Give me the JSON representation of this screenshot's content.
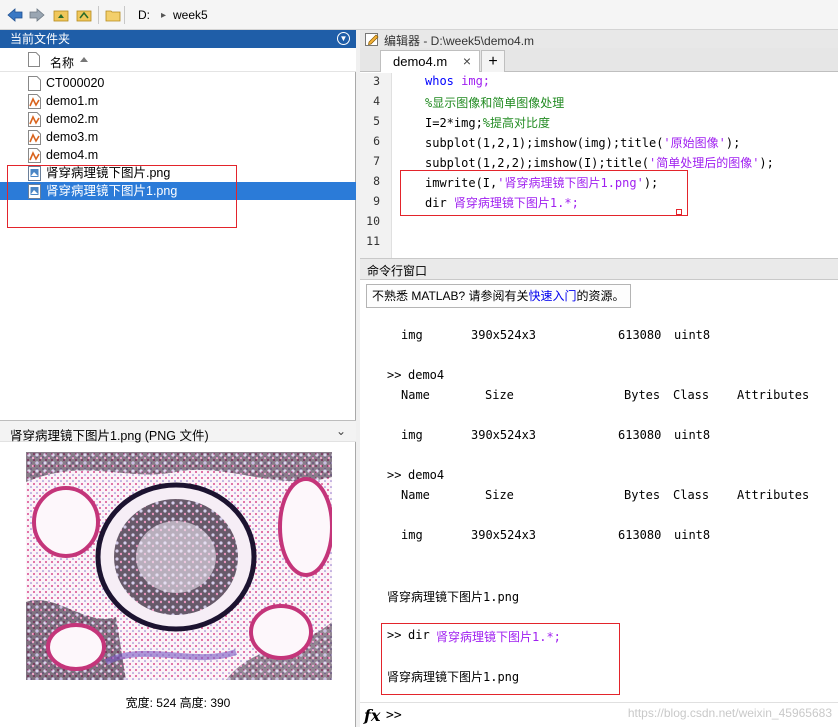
{
  "toolbar": {
    "path": [
      "D:",
      "week5"
    ],
    "separator": "▸"
  },
  "current_folder": {
    "title": "当前文件夹",
    "column_name": "名称",
    "files": [
      {
        "name": "CT000020",
        "icon": "blank-file-icon"
      },
      {
        "name": "demo1.m",
        "icon": "m-file-icon"
      },
      {
        "name": "demo2.m",
        "icon": "m-file-icon"
      },
      {
        "name": "demo3.m",
        "icon": "m-file-icon"
      },
      {
        "name": "demo4.m",
        "icon": "m-file-icon"
      },
      {
        "name": "肾穿病理镜下图片.png",
        "icon": "png-file-icon"
      },
      {
        "name": "肾穿病理镜下图片1.png",
        "icon": "png-file-icon",
        "selected": true
      }
    ]
  },
  "preview": {
    "title": "肾穿病理镜下图片1.png  (PNG 文件)",
    "dimensions": "宽度: 524 高度: 390"
  },
  "editor": {
    "title": "编辑器 - D:\\week5\\demo4.m",
    "tab_label": "demo4.m",
    "tab_close": "×",
    "add_tab": "+",
    "line_numbers": [
      "3",
      "4",
      "5",
      "6",
      "7",
      "8",
      "9",
      "10",
      "11"
    ],
    "lines": {
      "l3a": "whos ",
      "l3b": "img;",
      "l4": "%显示图像和简单图像处理",
      "l5a": "I=2*img;",
      "l5b": "%提高对比度",
      "l6a": "subplot(1,2,1);imshow(img);title(",
      "l6b": "'原始图像'",
      "l6c": ");",
      "l7a": "subplot(1,2,2);imshow(I);title(",
      "l7b": "'简单处理后的图像'",
      "l7c": ");",
      "l8a": "imwrite(I,",
      "l8b": "'肾穿病理镜下图片1.png'",
      "l8c": ");",
      "l9a": "dir ",
      "l9b": "肾穿病理镜下图片1.*;"
    }
  },
  "command_window": {
    "title": "命令行窗口",
    "notice_pre": "不熟悉 MATLAB? 请参阅有关",
    "notice_link": "快速入门",
    "notice_post": "的资源。",
    "var_row": {
      "name": "img",
      "size": "390x524x3",
      "bytes": "613080",
      "class": "uint8"
    },
    "prompt": ">>",
    "cmd_demo4": "demo4",
    "headers": {
      "name": "Name",
      "size": "Size",
      "bytes": "Bytes",
      "class": "Class",
      "attributes": "Attributes"
    },
    "output_file": "肾穿病理镜下图片1.png",
    "dir_cmd": "dir",
    "dir_arg": "肾穿病理镜下图片1.*;",
    "fx": "fx"
  },
  "watermark": "https://blog.csdn.net/weixin_45965683",
  "colors": {
    "header_blue": "#1f5ea8",
    "selection_blue": "#2b7bd8",
    "string_purple": "#a020f0",
    "comment_green": "#228b22",
    "keyword_blue": "#0000ff",
    "annotation_red": "#e3242b"
  }
}
